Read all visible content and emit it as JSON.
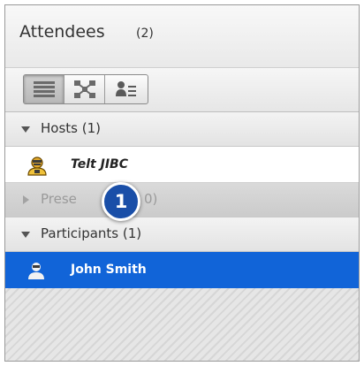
{
  "panel": {
    "title": "Attendees",
    "count": "(2)"
  },
  "toolbar": {
    "views": [
      {
        "icon": "list-view-icon",
        "active": true
      },
      {
        "icon": "breakout-view-icon",
        "active": false
      },
      {
        "icon": "attendee-details-icon",
        "active": false
      }
    ]
  },
  "sections": {
    "hosts": {
      "label": "Hosts (1)",
      "expanded": true
    },
    "presenters": {
      "label_start": "Prese",
      "label_end": "0)",
      "expanded": false
    },
    "participants": {
      "label": "Participants (1)",
      "expanded": true
    }
  },
  "hosts": [
    {
      "name": "Telt JIBC",
      "icon": "host-avatar-icon"
    }
  ],
  "participants": [
    {
      "name": "John Smith",
      "icon": "participant-avatar-icon",
      "selected": true
    }
  ],
  "callout": {
    "number": "1"
  },
  "colors": {
    "selection": "#1164d8",
    "callout": "#1a4fa8"
  }
}
